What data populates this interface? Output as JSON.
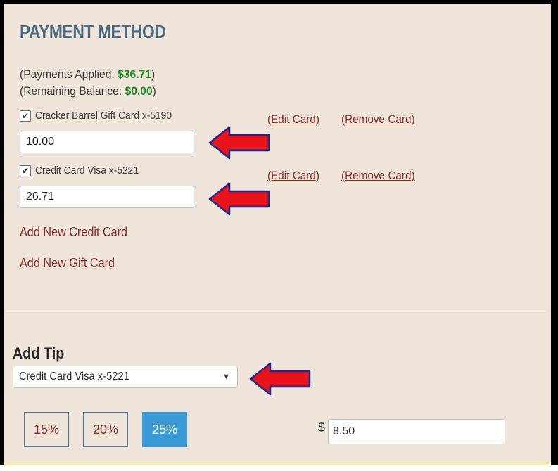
{
  "payment_method": {
    "title": "PAYMENT METHOD",
    "applied": {
      "prefix": "(Payments Applied: ",
      "amount": "$36.71",
      "suffix": ")"
    },
    "remaining": {
      "prefix": "(Remaining Balance: ",
      "amount": "$0.00",
      "suffix": ")"
    },
    "cards": [
      {
        "label": "Cracker Barrel Gift Card x-5190",
        "checked": true,
        "amount": "10.00",
        "edit_label": "(Edit Card)",
        "remove_label": "(Remove Card)"
      },
      {
        "label": "Credit Card Visa x-5221",
        "checked": true,
        "amount": "26.71",
        "edit_label": "(Edit Card)",
        "remove_label": "(Remove Card)"
      }
    ],
    "add_credit_card_label": "Add New Credit Card",
    "add_gift_card_label": "Add New Gift Card"
  },
  "tip": {
    "title": "Add Tip",
    "selected_card": "Credit Card Visa x-5221",
    "percent_buttons": [
      "15%",
      "20%",
      "25%"
    ],
    "active_percent": "25%",
    "currency_symbol": "$",
    "amount": "8.50"
  },
  "colors": {
    "panel_bg": "#efe5da",
    "heading": "#4a6b82",
    "link": "#8a2a2a",
    "amount_green": "#1d8a1d",
    "active_button": "#3a9ad6",
    "arrow_red": "#e8131b",
    "arrow_outline": "#1b2a8c"
  },
  "icons": {
    "checkbox": "checkmark-icon",
    "select_caret": "triangle-down-icon",
    "annotation": "red-arrow-icon"
  }
}
